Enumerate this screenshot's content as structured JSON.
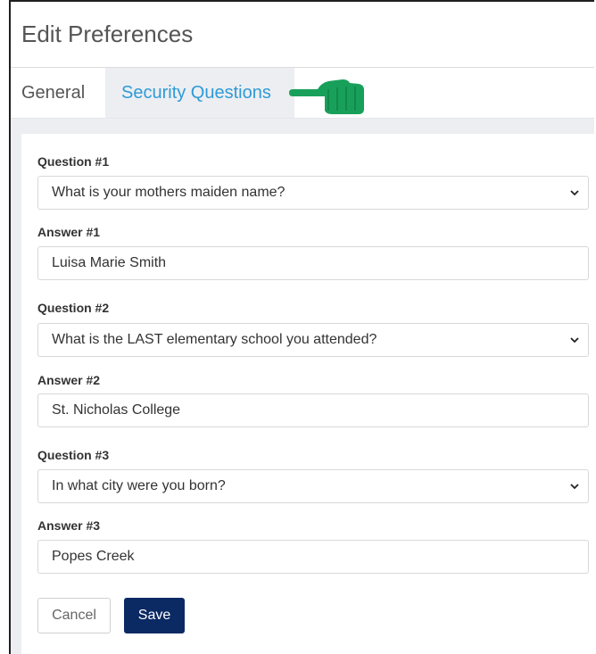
{
  "dialog": {
    "title": "Edit Preferences"
  },
  "tabs": {
    "general": "General",
    "security": "Security Questions"
  },
  "form": {
    "q1": {
      "label": "Question #1",
      "value": "What is your mothers maiden name?"
    },
    "a1": {
      "label": "Answer #1",
      "value": "Luisa Marie Smith"
    },
    "q2": {
      "label": "Question #2",
      "value": "What is the LAST elementary school you attended?"
    },
    "a2": {
      "label": "Answer #2",
      "value": "St. Nicholas College"
    },
    "q3": {
      "label": "Question #3",
      "value": "In what city were you born?"
    },
    "a3": {
      "label": "Answer #3",
      "value": "Popes Creek"
    }
  },
  "buttons": {
    "cancel": "Cancel",
    "save": "Save"
  },
  "icons": {
    "pointer": "pointing-hand-icon",
    "select_arrow": "chevron-down-icon"
  },
  "colors": {
    "active_tab": "#2f9ad6",
    "save_button": "#0b2a63",
    "hand": "#18a05a"
  }
}
